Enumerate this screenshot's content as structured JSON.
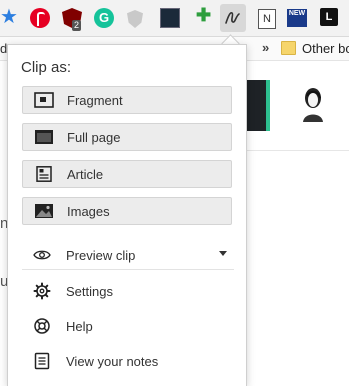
{
  "toolbar": {
    "extensions": [
      {
        "name": "bookmark-star-icon"
      },
      {
        "name": "pinterest-icon"
      },
      {
        "name": "ublock-icon",
        "badge": "2"
      },
      {
        "name": "grammarly-icon",
        "glyph": "G"
      },
      {
        "name": "privacy-shield-icon"
      },
      {
        "name": "dark-extension-icon"
      },
      {
        "name": "green-plus-icon"
      },
      {
        "name": "evernote-clipper-icon"
      },
      {
        "name": "notes-icon",
        "glyph": "N"
      },
      {
        "name": "news-icon",
        "glyph": "NEW"
      },
      {
        "name": "l-extension-icon",
        "glyph": "L"
      }
    ]
  },
  "bookmarks_bar": {
    "left_fragment": "d",
    "overflow": "»",
    "other_label": "Other bo"
  },
  "page_behind": {
    "fragment_1": "n",
    "fragment_2": "u"
  },
  "popup": {
    "title": "Clip as:",
    "clip_options": [
      {
        "label": "Fragment",
        "icon": "fragment-icon"
      },
      {
        "label": "Full page",
        "icon": "full-page-icon"
      },
      {
        "label": "Article",
        "icon": "article-icon"
      },
      {
        "label": "Images",
        "icon": "images-icon"
      }
    ],
    "preview_clip": {
      "label": "Preview clip",
      "icon": "eye-icon"
    },
    "menu": [
      {
        "label": "Settings",
        "icon": "gear-icon"
      },
      {
        "label": "Help",
        "icon": "lifebuoy-icon"
      },
      {
        "label": "View your notes",
        "icon": "notes-list-icon"
      }
    ]
  },
  "colors": {
    "accent_green": "#2dbf8f",
    "button_bg": "#ececec",
    "text": "#333333"
  }
}
